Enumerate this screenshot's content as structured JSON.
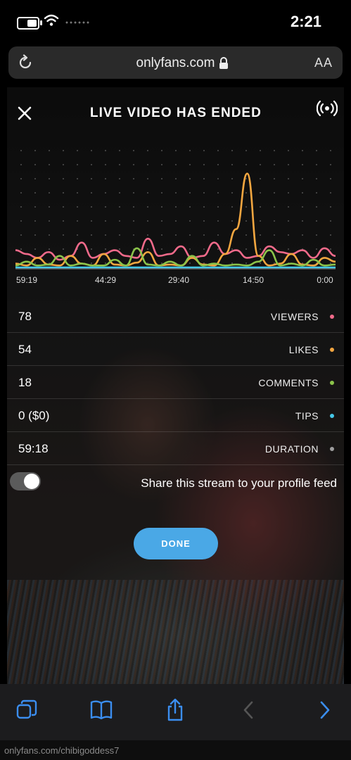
{
  "status": {
    "time": "2:21",
    "battery_level": 0.55
  },
  "browser": {
    "url": "onlyfans.com",
    "text_size_label": "AA"
  },
  "stream": {
    "title": "LIVE VIDEO HAS ENDED",
    "chart_data": {
      "type": "line",
      "x_tick_labels": [
        "59:19",
        "44:29",
        "29:40",
        "14:50",
        "0:00"
      ],
      "series": [
        {
          "color": "#f06a8a",
          "values": [
            18,
            14,
            10,
            16,
            8,
            12,
            26,
            10,
            14,
            18,
            12,
            10,
            30,
            12,
            14,
            22,
            10,
            12,
            26,
            14,
            18,
            10,
            12,
            22,
            16,
            14,
            18,
            10,
            20,
            12
          ]
        },
        {
          "color": "#f2a640",
          "values": [
            4,
            2,
            10,
            3,
            2,
            12,
            4,
            2,
            14,
            3,
            2,
            5,
            16,
            2,
            3,
            2,
            10,
            3,
            2,
            14,
            40,
            98,
            12,
            2,
            4,
            14,
            3,
            2,
            10,
            6
          ]
        },
        {
          "color": "#8bc34a",
          "values": [
            2,
            6,
            2,
            3,
            12,
            2,
            4,
            2,
            2,
            8,
            2,
            20,
            3,
            2,
            6,
            2,
            12,
            2,
            4,
            2,
            3,
            2,
            6,
            18,
            2,
            4,
            2,
            8,
            2,
            3
          ]
        },
        {
          "color": "#45c8e8",
          "values": [
            0,
            0,
            0,
            0,
            0,
            0,
            0,
            0,
            0,
            0,
            0,
            0,
            0,
            0,
            0,
            0,
            0,
            0,
            0,
            0,
            0,
            0,
            0,
            0,
            0,
            0,
            0,
            0,
            0,
            0
          ]
        }
      ]
    },
    "stats": [
      {
        "label": "VIEWERS",
        "value": "78",
        "color": "#f06a8a"
      },
      {
        "label": "LIKES",
        "value": "54",
        "color": "#f2a640"
      },
      {
        "label": "COMMENTS",
        "value": "18",
        "color": "#8bc34a"
      },
      {
        "label": "TIPS",
        "value": "0 ($0)",
        "color": "#45c8e8"
      },
      {
        "label": "DURATION",
        "value": "59:18",
        "color": "#9e9e9e"
      }
    ],
    "share_label": "Share this stream to your profile feed",
    "share_enabled": true,
    "done_label": "DONE"
  },
  "footer": {
    "text": "onlyfans.com/chibigoddess7"
  }
}
